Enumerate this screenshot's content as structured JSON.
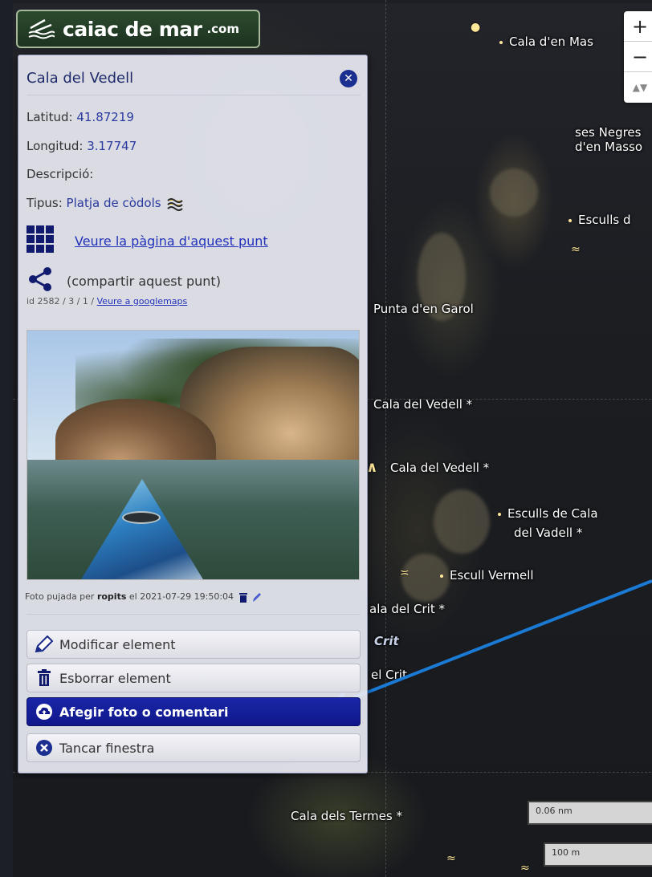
{
  "logo": {
    "text": "caiac de mar",
    "tld": ".com"
  },
  "map": {
    "labels": [
      {
        "id": "cala-den-mas",
        "text": "Cala d'en Mas"
      },
      {
        "id": "ses-negres",
        "text": "ses Negres"
      },
      {
        "id": "den-masso",
        "text": "d'en Masso"
      },
      {
        "id": "esculls-d",
        "text": "Esculls d"
      },
      {
        "id": "punta-den-garol",
        "text": "Punta d'en Garol"
      },
      {
        "id": "cala-del-vedell-1",
        "text": "Cala del Vedell *"
      },
      {
        "id": "cala-del-vedell-2",
        "text": "Cala del Vedell *"
      },
      {
        "id": "esculls-de-cala",
        "text": "Esculls de Cala"
      },
      {
        "id": "del-vadell",
        "text": "del Vadell *"
      },
      {
        "id": "escull-vermell",
        "text": "Escull Vermell"
      },
      {
        "id": "cala-del-crit",
        "text": "ala del Crit *"
      },
      {
        "id": "crit",
        "text": "Crit"
      },
      {
        "id": "el-crit",
        "text": "el Crit"
      },
      {
        "id": "cala-dels-termes",
        "text": "Cala dels Termes *"
      }
    ],
    "zoom": {
      "in": "+",
      "out": "−",
      "reset": "▲▼"
    },
    "scale": {
      "nautical": "0.06 nm",
      "metric": "100 m"
    }
  },
  "popup": {
    "title": "Cala del Vedell",
    "latitude_label": "Latitud: ",
    "latitude": "41.87219",
    "longitude_label": "Longitud: ",
    "longitude": "3.17747",
    "description_label": "Descripció:",
    "type_label": "Tipus: ",
    "type_value": "Platja de còdols",
    "page_link": "Veure la pàgina d'aquest punt",
    "share_text": "(compartir aquest punt)",
    "id_text": "id 2582 / 3 / 1 / ",
    "googlemaps_link": "Veure a googlemaps",
    "credit_prefix": "Foto pujada per ",
    "credit_user": "ropits",
    "credit_suffix": " el 2021-07-29 19:50:04",
    "buttons": {
      "modify": "Modificar element",
      "delete": "Esborrar element",
      "add_photo": "Afegir foto o comentari",
      "close": "Tancar finestra"
    }
  },
  "colors": {
    "accent": "#0f178a",
    "arrow": "#1a7ad4",
    "link": "#2233bb"
  }
}
